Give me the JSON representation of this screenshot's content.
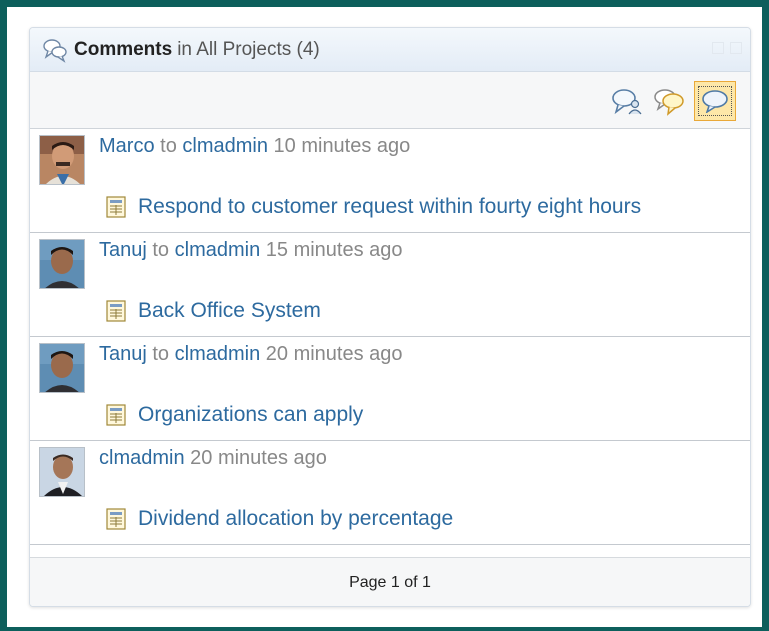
{
  "widget": {
    "title_bold": "Comments",
    "title_rest": "in All Projects (4)",
    "footer_text": "Page 1 of 1"
  },
  "toolbar": {
    "buttons": [
      {
        "icon": "comments-by-user-icon"
      },
      {
        "icon": "comments-by-me-icon"
      },
      {
        "icon": "all-comments-icon",
        "selected": true
      }
    ]
  },
  "comments": [
    {
      "author": "Marco",
      "to_word": "to",
      "recipient": "clmadmin",
      "time": "10 minutes ago",
      "item": "Respond to customer request within fourty eight hours",
      "avatar": "avatar-marco"
    },
    {
      "author": "Tanuj",
      "to_word": "to",
      "recipient": "clmadmin",
      "time": "15 minutes ago",
      "item": "Back Office System",
      "avatar": "avatar-tanuj"
    },
    {
      "author": "Tanuj",
      "to_word": "to",
      "recipient": "clmadmin",
      "time": "20 minutes ago",
      "item": "Organizations can apply",
      "avatar": "avatar-tanuj"
    },
    {
      "author": "clmadmin",
      "to_word": "",
      "recipient": "",
      "time": "20 minutes ago",
      "item": "Dividend allocation by percentage",
      "avatar": "avatar-clmadmin"
    }
  ],
  "colors": {
    "frame": "#0d5f5c",
    "link": "#2d6a9f",
    "selected_button_bg": "#fde7a8",
    "selected_button_border": "#e9a838"
  }
}
